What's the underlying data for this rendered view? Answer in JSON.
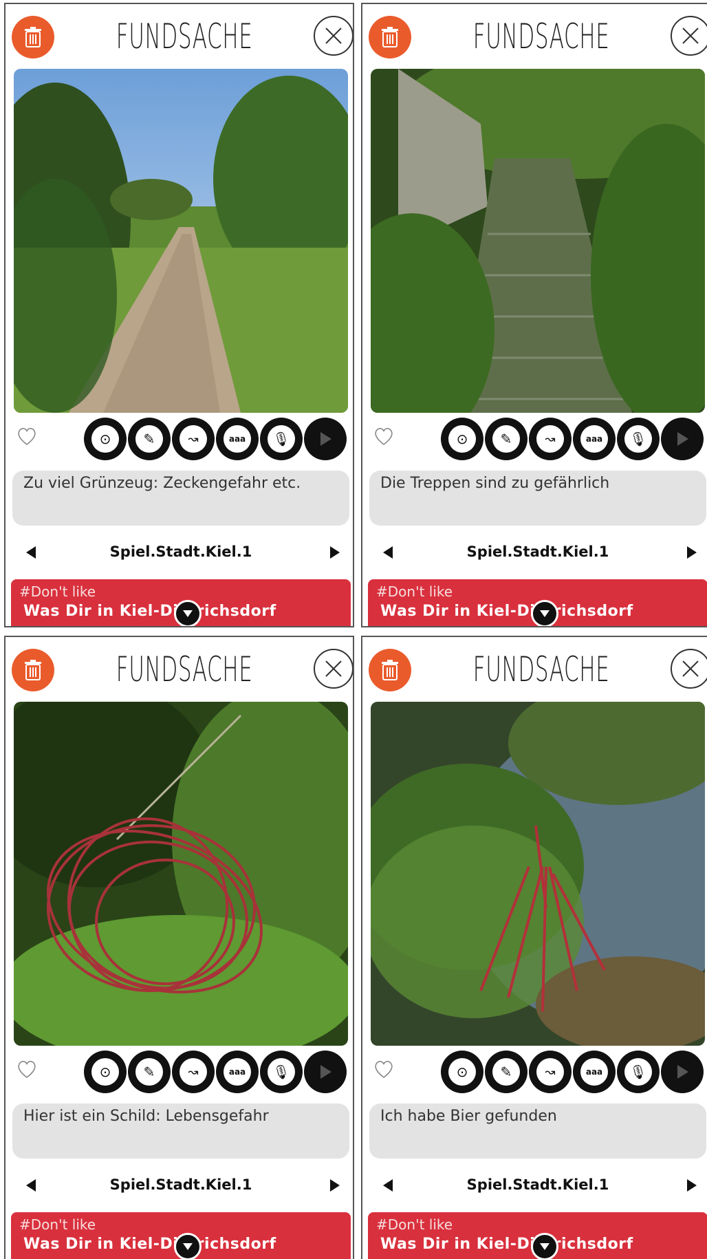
{
  "app": {
    "title": "FUNDSACHE"
  },
  "colors": {
    "trash": "#ea5b2c",
    "card": "#d9303d",
    "comment_bg": "#e3e3e3"
  },
  "toolbar": {
    "icons": [
      "location-pin-icon",
      "pencil-icon",
      "route-icon",
      "text-icon",
      "microphone-icon",
      "play-icon"
    ]
  },
  "screens": [
    {
      "comment": "Zu viel Grünzeug: Zeckengefahr etc.",
      "project": "Spiel.Stadt.Kiel.1",
      "card_tag": "#Don't like",
      "card_title": "Was Dir in Kiel-Dietrichsdorf",
      "photo": "wooden boardwalk path through grass"
    },
    {
      "comment": "Die Treppen sind zu gefährlich",
      "project": "Spiel.Stadt.Kiel.1",
      "card_tag": "#Don't like",
      "card_title": "Was Dir in Kiel-Dietrichsdorf",
      "photo": "overgrown stone stairs beside fence"
    },
    {
      "comment": "Hier ist ein Schild: Lebensgefahr",
      "project": "Spiel.Stadt.Kiel.1",
      "card_tag": "#Don't like",
      "card_title": "Was Dir in Kiel-Dietrichsdorf",
      "photo": "bushes with red circles drawn"
    },
    {
      "comment": "Ich habe Bier gefunden",
      "project": "Spiel.Stadt.Kiel.1",
      "card_tag": "#Don't like",
      "card_title": "Was Dir in Kiel-Dietrichsdorf",
      "photo": "pond with leaves and red lines drawn"
    }
  ]
}
